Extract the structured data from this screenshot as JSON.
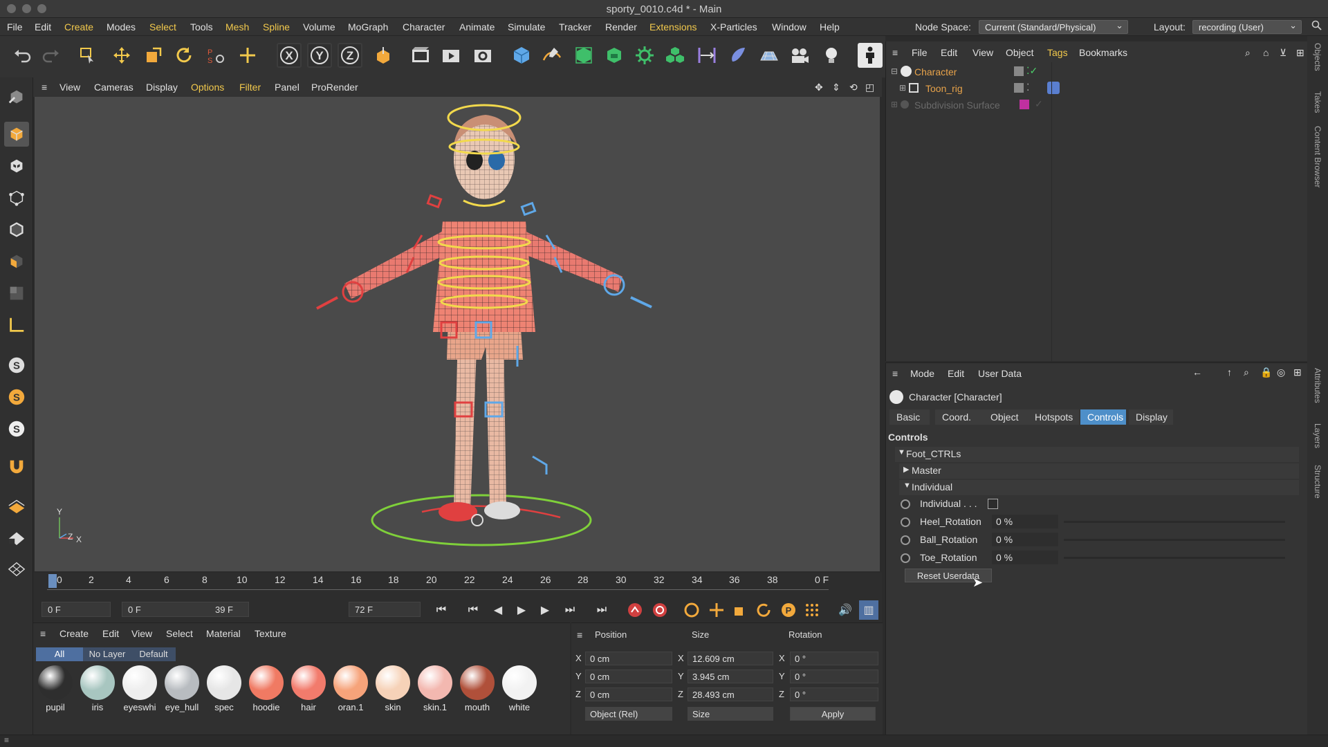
{
  "window": {
    "title": "sporty_0010.c4d * - Main"
  },
  "menu": {
    "items": [
      "File",
      "Edit",
      "Create",
      "Modes",
      "Select",
      "Tools",
      "Mesh",
      "Spline",
      "Volume",
      "MoGraph",
      "Character",
      "Animate",
      "Simulate",
      "Tracker",
      "Render",
      "Extensions",
      "X-Particles",
      "Window",
      "Help"
    ],
    "node_space_label": "Node Space:",
    "node_space_value": "Current (Standard/Physical)",
    "layout_label": "Layout:",
    "layout_value": "recording (User)"
  },
  "toolbar": {
    "axis_labels": [
      "X",
      "Y",
      "Z"
    ]
  },
  "viewport": {
    "menu": [
      "View",
      "Cameras",
      "Display",
      "Options",
      "Filter",
      "Panel",
      "ProRender"
    ],
    "axis_y": "Y",
    "axis_x": "X",
    "axis_z": "Z"
  },
  "timeline": {
    "ticks": [
      "0",
      "2",
      "4",
      "6",
      "8",
      "10",
      "12",
      "14",
      "16",
      "18",
      "20",
      "22",
      "24",
      "26",
      "28",
      "30",
      "32",
      "34",
      "36",
      "38"
    ],
    "current_frame": "0 F",
    "start_field": "0 F",
    "range_start": "0 F",
    "range_end": "39 F",
    "end_field": "72 F"
  },
  "material_manager": {
    "menu": [
      "Create",
      "Edit",
      "View",
      "Select",
      "Material",
      "Texture"
    ],
    "filters": [
      "All",
      "No Layer",
      "Default"
    ],
    "materials": [
      {
        "name": "pupil",
        "color": "#2e2e2e"
      },
      {
        "name": "iris",
        "color": "#a8c6c0"
      },
      {
        "name": "eyeswhi",
        "color": "#eeeeee"
      },
      {
        "name": "eye_hull",
        "color": "#b8bcc0"
      },
      {
        "name": "spec",
        "color": "#e6e6e6"
      },
      {
        "name": "hoodie",
        "color": "#f07a63"
      },
      {
        "name": "hair",
        "color": "#f27b6c"
      },
      {
        "name": "oran.1",
        "color": "#f6a37a"
      },
      {
        "name": "skin",
        "color": "#f6d2b8"
      },
      {
        "name": "skin.1",
        "color": "#f3b8b0"
      },
      {
        "name": "mouth",
        "color": "#b0503a"
      },
      {
        "name": "white",
        "color": "#f2f2f2"
      }
    ]
  },
  "coordinates": {
    "headers": {
      "position": "Position",
      "size": "Size",
      "rotation": "Rotation"
    },
    "rows": [
      {
        "axis": "X",
        "pos": "0 cm",
        "size": "12.609 cm",
        "rot_axis": "X",
        "rot": "0 °"
      },
      {
        "axis": "Y",
        "pos": "0 cm",
        "size": "3.945 cm",
        "rot_axis": "Y",
        "rot": "0 °"
      },
      {
        "axis": "Z",
        "pos": "0 cm",
        "size": "28.493 cm",
        "rot_axis": "Z",
        "rot": "0 °"
      }
    ],
    "mode": "Object (Rel)",
    "size_mode": "Size",
    "apply": "Apply"
  },
  "object_manager": {
    "menu": [
      "File",
      "Edit",
      "View",
      "Object",
      "Tags",
      "Bookmarks"
    ],
    "objects": [
      {
        "name": "Character",
        "color": "#e8a34a"
      },
      {
        "name": "Toon_rig",
        "color": "#e8a34a"
      },
      {
        "name": "Subdivision Surface",
        "color": "#6a6a6a"
      }
    ]
  },
  "attributes": {
    "menu": [
      "Mode",
      "Edit",
      "User Data"
    ],
    "object_title": "Character [Character]",
    "tabs": [
      "Basic",
      "Coord.",
      "Object",
      "Hotspots",
      "Controls",
      "Display"
    ],
    "active_tab": "Controls",
    "section": "Controls",
    "group": "Foot_CTRLs",
    "master": "Master",
    "individual_group": "Individual",
    "individual_label": "Individual . . .",
    "params": [
      {
        "label": "Heel_Rotation",
        "value": "0 %"
      },
      {
        "label": "Ball_Rotation",
        "value": "0 %"
      },
      {
        "label": "Toe_Rotation",
        "value": "0 %"
      }
    ],
    "reset_button": "Reset Userdata"
  },
  "right_strip": [
    "Objects",
    "Takes",
    "Content Browser",
    "Attributes",
    "Layers",
    "Structure"
  ]
}
